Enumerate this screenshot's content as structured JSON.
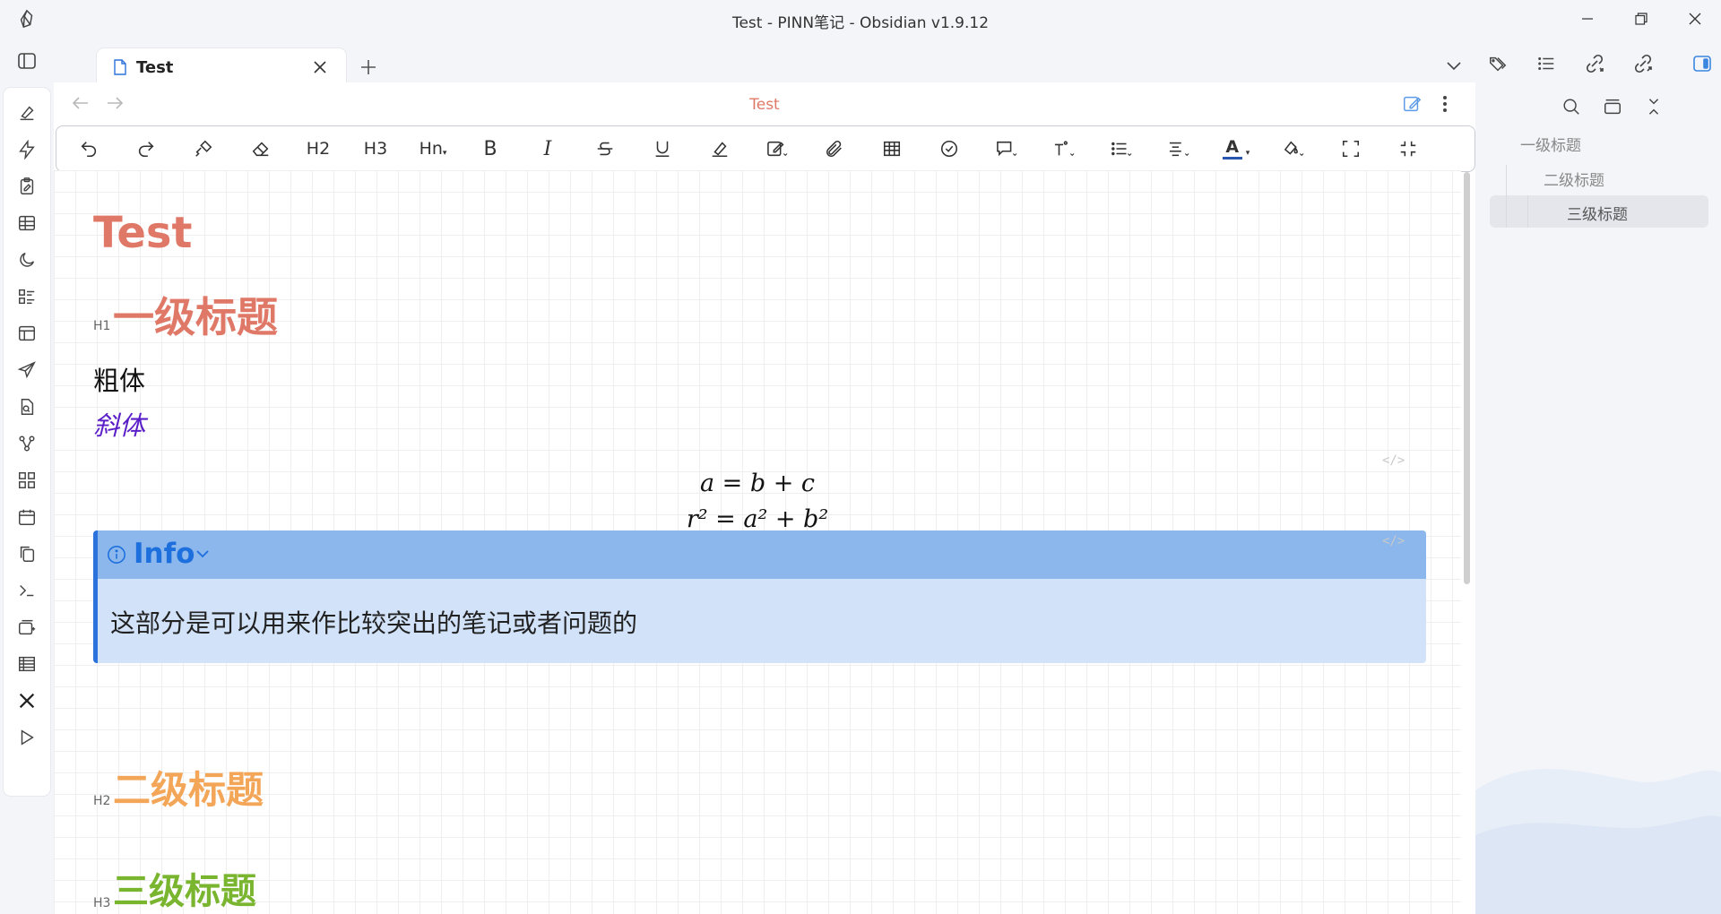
{
  "window": {
    "title": "Test - PINN笔记 - Obsidian v1.9.12"
  },
  "tabs": [
    {
      "label": "Test",
      "active": true
    }
  ],
  "editor": {
    "note_title": "Test"
  },
  "toolbar": {
    "h2": "H2",
    "h3": "H3",
    "hn": "Hn",
    "bold": "B",
    "italic": "I",
    "font_color_letter": "A"
  },
  "document": {
    "title": "Test",
    "h1_marker": "H1",
    "h1": "一级标题",
    "bold_text": "粗体",
    "italic_text": "斜体",
    "math_line1": "a = b + c",
    "math_line2": "r² = a² + b²",
    "code_indicator": "</>",
    "callout": {
      "title": "Info",
      "body": "这部分是可以用来作比较突出的笔记或者问题的"
    },
    "h2_marker": "H2",
    "h2": "二级标题",
    "h3_marker": "H3",
    "h3": "三级标题"
  },
  "outline": [
    {
      "label": "一级标题",
      "level": 1
    },
    {
      "label": "二级标题",
      "level": 2
    },
    {
      "label": "三级标题",
      "level": 3,
      "active": true
    }
  ],
  "colors": {
    "accent_red": "#e07868",
    "h2_orange": "#f3a657",
    "h3_green": "#7ab530",
    "italic_purple": "#5a1ec8",
    "callout_blue": "#2c72dc"
  }
}
